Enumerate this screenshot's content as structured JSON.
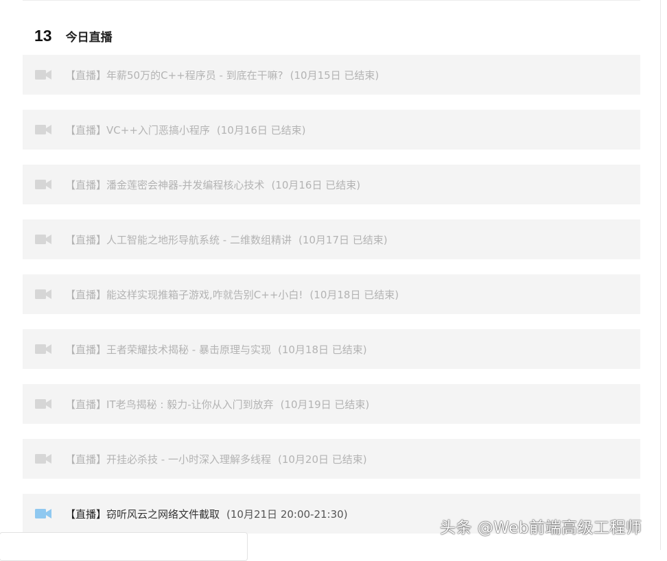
{
  "section": {
    "number": "13",
    "title": "今日直播"
  },
  "colors": {
    "item_background": "#f4f4f4",
    "inactive_text": "#b3b3b3",
    "active_icon": "#8fc8f0",
    "inactive_icon": "#d6d6d6"
  },
  "lessons": [
    {
      "tag": "【直播】",
      "title": "年薪50万的C++程序员 - 到底在干嘛?",
      "date": "(10月15日 已结束)",
      "icon": "video-camera-icon",
      "active": false
    },
    {
      "tag": "【直播】",
      "title": "VC++入门恶搞小程序",
      "date": "(10月16日 已结束)",
      "icon": "video-camera-icon",
      "active": false
    },
    {
      "tag": "【直播】",
      "title": "潘金莲密会神器-并发编程核心技术",
      "date": "(10月16日 已结束)",
      "icon": "video-camera-icon",
      "active": false
    },
    {
      "tag": "【直播】",
      "title": "人工智能之地形导航系统 - 二维数组精讲",
      "date": "(10月17日 已结束)",
      "icon": "video-camera-icon",
      "active": false
    },
    {
      "tag": "【直播】",
      "title": "能这样实现推箱子游戏,咋就告别C++小白!",
      "date": "(10月18日 已结束)",
      "icon": "video-camera-icon",
      "active": false
    },
    {
      "tag": "【直播】",
      "title": "王者荣耀技术揭秘 - 暴击原理与实现",
      "date": "(10月18日 已结束)",
      "icon": "video-camera-icon",
      "active": false
    },
    {
      "tag": "【直播】",
      "title": "IT老鸟揭秘 : 毅力-让你从入门到放弃",
      "date": "(10月19日 已结束)",
      "icon": "video-camera-icon",
      "active": false
    },
    {
      "tag": "【直播】",
      "title": "开挂必杀技 - 一小时深入理解多线程",
      "date": "(10月20日 已结束)",
      "icon": "video-camera-icon",
      "active": false
    },
    {
      "tag": "【直播】",
      "title": "窃听风云之网络文件截取",
      "date": "(10月21日 20:00-21:30)",
      "icon": "video-camera-icon",
      "active": true
    }
  ],
  "watermark": "头条 @Web前端高级工程师"
}
